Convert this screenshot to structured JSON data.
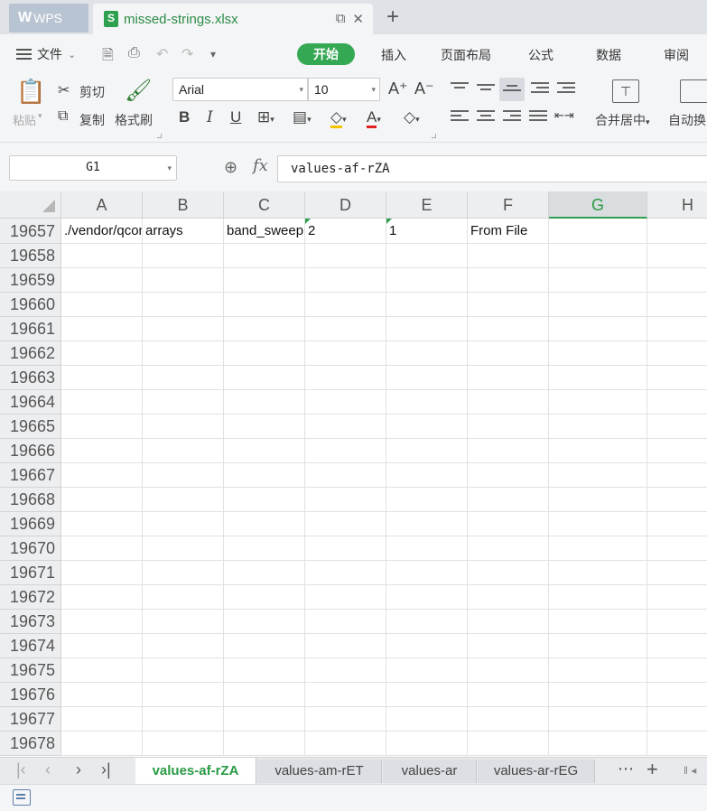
{
  "titlebar": {
    "app_tab": "WPS",
    "file_name": "missed-strings.xlsx"
  },
  "menu": {
    "file": "文件",
    "items": [
      "开始",
      "插入",
      "页面布局",
      "公式",
      "数据",
      "审阅"
    ]
  },
  "ribbon": {
    "paste": "粘贴",
    "cut": "剪切",
    "copy": "复制",
    "format_painter": "格式刷",
    "font_name": "Arial",
    "font_size": "10",
    "merge_center": "合并居中",
    "auto_wrap": "自动换"
  },
  "formula_bar": {
    "name_box": "G1",
    "fx": "fx",
    "formula": "values-af-rZA"
  },
  "grid": {
    "columns": [
      "A",
      "B",
      "C",
      "D",
      "E",
      "F",
      "G",
      "H"
    ],
    "selected_column": "G",
    "row_numbers": [
      "19657",
      "19658",
      "19659",
      "19660",
      "19661",
      "19662",
      "19663",
      "19664",
      "19665",
      "19666",
      "19667",
      "19668",
      "19669",
      "19670",
      "19671",
      "19672",
      "19673",
      "19674",
      "19675",
      "19676",
      "19677",
      "19678"
    ],
    "first_row": [
      "./vendor/qcom",
      "arrays",
      "band_sweep",
      "2",
      "1",
      "From File",
      "",
      ""
    ]
  },
  "sheets": {
    "tabs": [
      "values-af-rZA",
      "values-am-rET",
      "values-ar",
      "values-ar-rEG"
    ],
    "active": "values-af-rZA"
  },
  "colors": {
    "accent": "#2ea04f",
    "start_pill": "#35a853"
  }
}
